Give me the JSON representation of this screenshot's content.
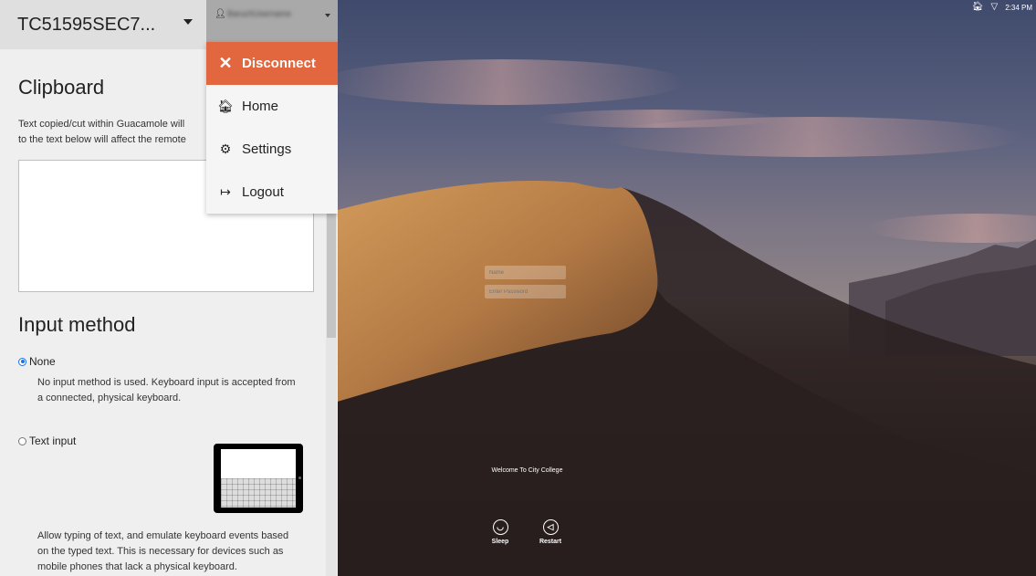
{
  "sidebar": {
    "connection_name": "TC51595SEC7...",
    "username": "BaruchUsername",
    "clipboard": {
      "title": "Clipboard",
      "description_line1": "Text copied/cut within Guacamole will",
      "description_line2": "to the text below will affect the remote",
      "value": ""
    },
    "input_method": {
      "title": "Input method",
      "options": [
        {
          "label": "None",
          "selected": true,
          "desc_line1": "No input method is used. Keyboard input is accepted from",
          "desc_line2": "a connected, physical keyboard."
        },
        {
          "label": "Text input",
          "selected": false,
          "desc_line1": "Allow typing of text, and emulate keyboard events based",
          "desc_line2": "on the typed text. This is necessary for devices such as",
          "desc_line3": "mobile phones that lack a physical keyboard."
        }
      ]
    }
  },
  "user_menu": {
    "items": [
      {
        "label": "Disconnect",
        "icon": "close-icon"
      },
      {
        "label": "Home",
        "icon": "home-icon"
      },
      {
        "label": "Settings",
        "icon": "gear-icon"
      },
      {
        "label": "Logout",
        "icon": "logout-icon"
      }
    ]
  },
  "remote_desktop": {
    "status_time": "2:34 PM",
    "login": {
      "name_placeholder": "Name",
      "password_placeholder": "Enter Password"
    },
    "welcome_message": "Welcome To City College",
    "sleep_label": "Sleep",
    "restart_label": "Restart"
  },
  "colors": {
    "disconnect_accent": "#e2673f",
    "radio_selected": "#1a73e8"
  }
}
